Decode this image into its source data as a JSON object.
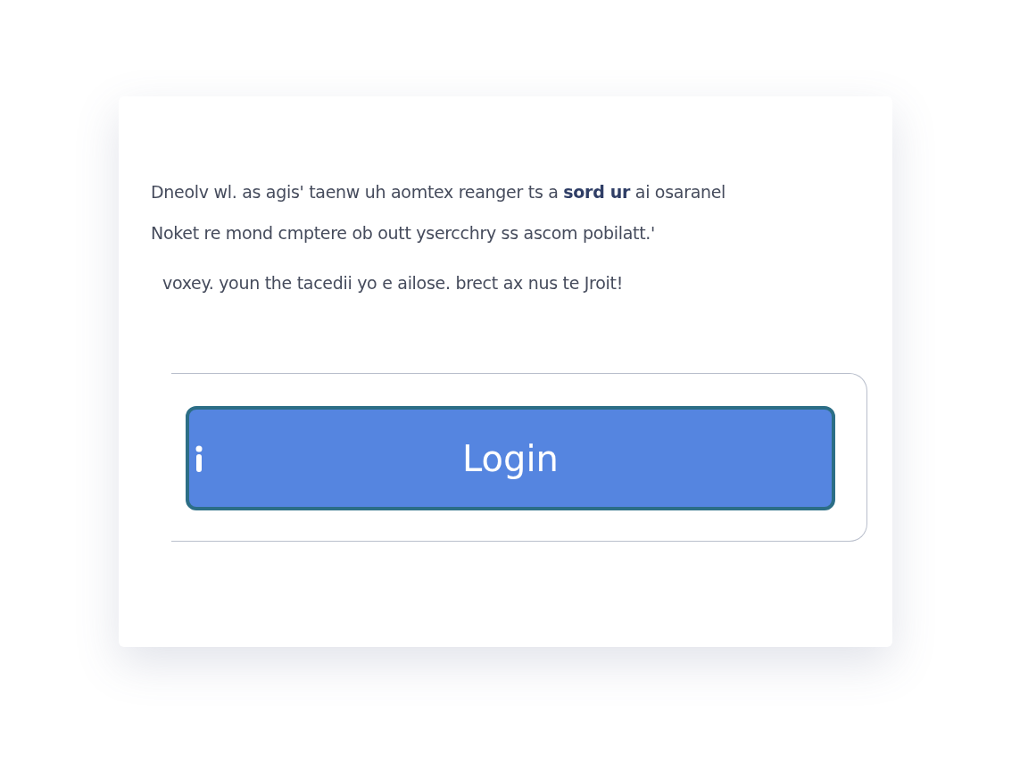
{
  "card": {
    "paragraph_lines": [
      "Dneolv wl. as agis' taenw uh aomtex reanger ts a **sord ur** ai osaranel",
      "Noket re mond cmptere ob outt ysercchry ss ascom pobilatt.'",
      "voxey. youn the tacedii yo e ailose. brect ax nus te Jroit!"
    ],
    "login_button": {
      "label": "Login"
    }
  }
}
